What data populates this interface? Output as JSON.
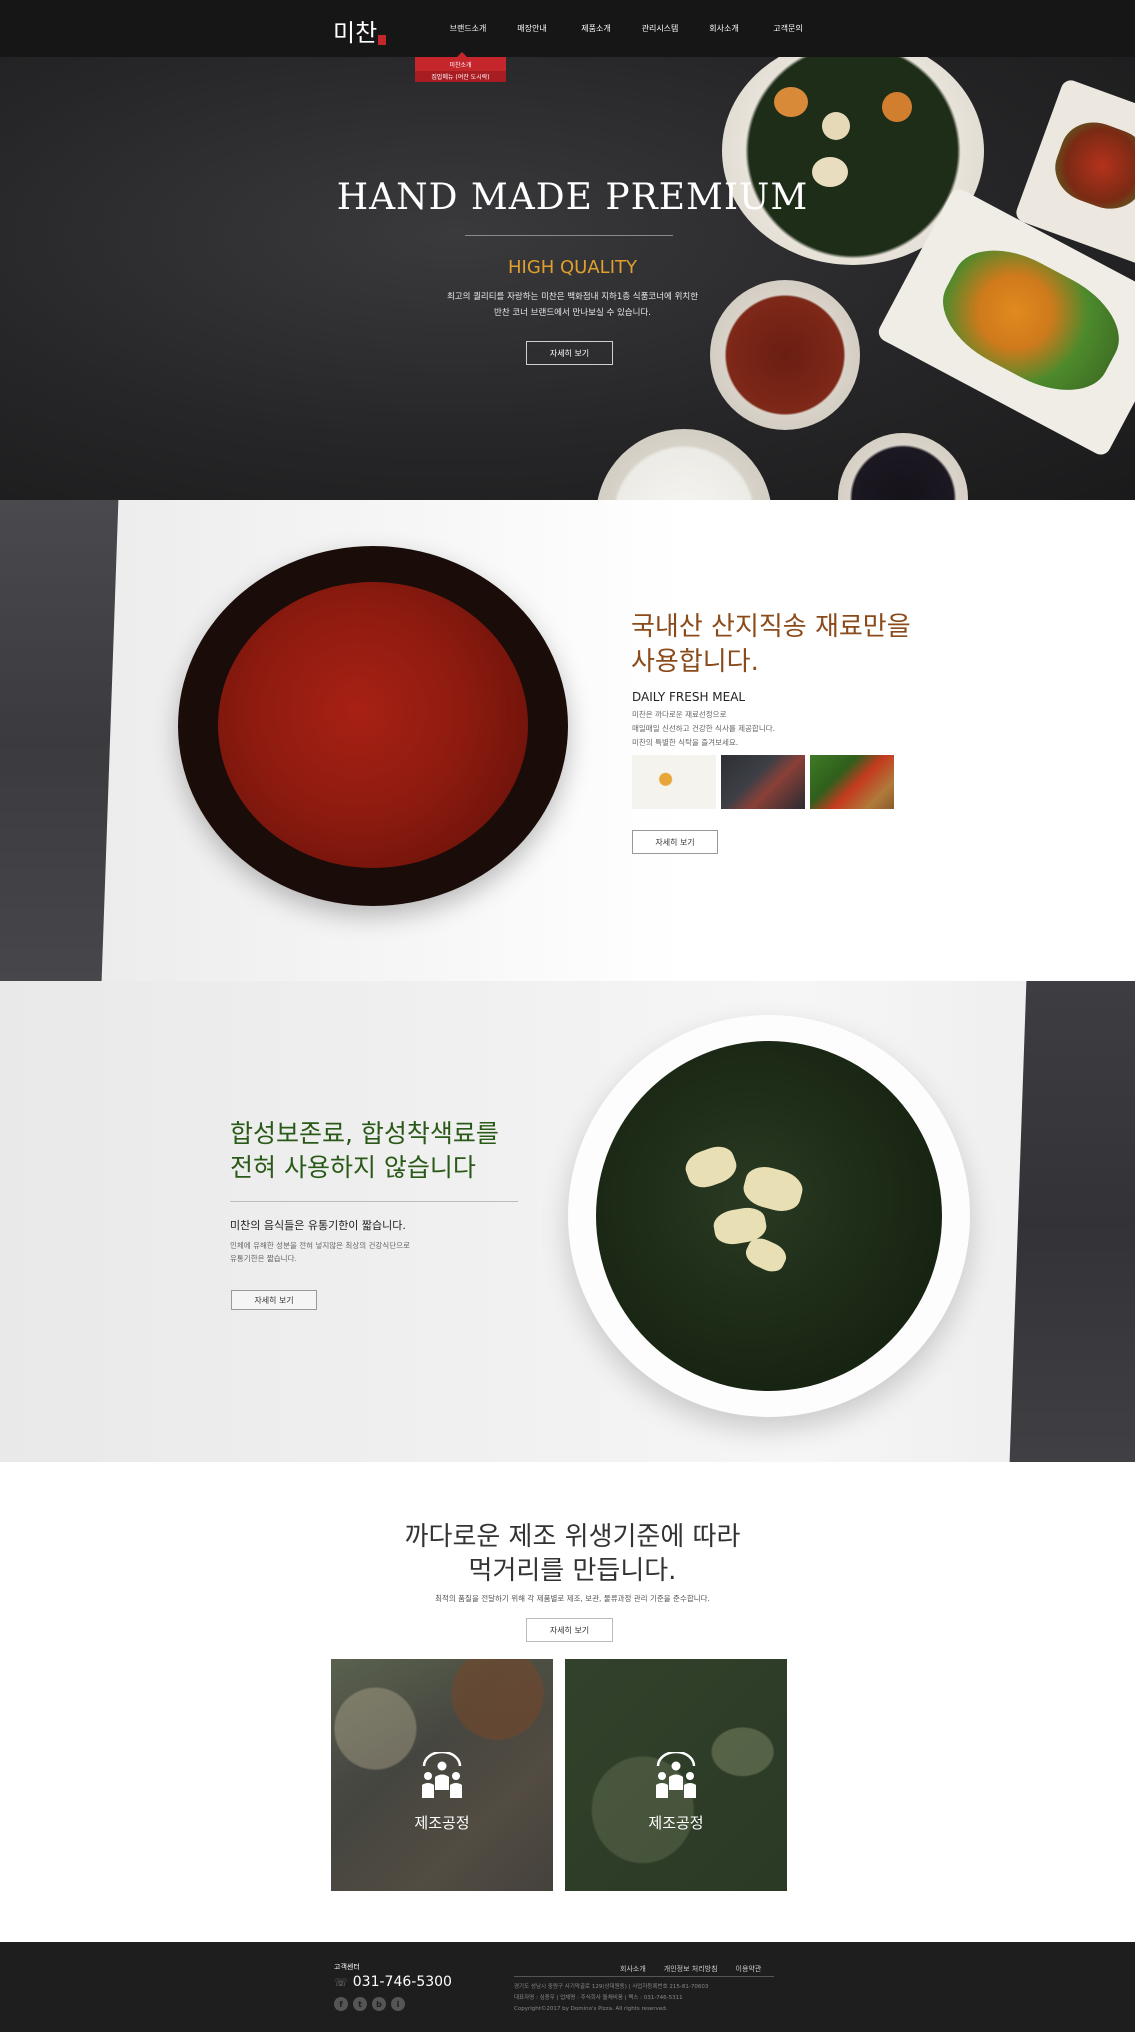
{
  "header": {
    "logo": "미찬",
    "nav": [
      "브랜드소개",
      "매장안내",
      "제품소개",
      "관리시스템",
      "회사소개",
      "고객문의"
    ],
    "dropdown": [
      "미찬소개",
      "집밥메뉴 (여잔 도시락)"
    ]
  },
  "hero": {
    "title": "HAND MADE PREMIUM",
    "subtitle": "HIGH QUALITY",
    "desc_line1": "최고의 퀄리티를 자랑하는 미찬은 백화점내 지하1층 식품코너에 위치한",
    "desc_line2": "반찬 코너 브랜드에서 만나보실 수 있습니다.",
    "button": "자세히 보기"
  },
  "section2": {
    "title_line1": "국내산 산지직송 재료만을",
    "title_line2": "사용합니다.",
    "subtitle": "DAILY FRESH MEAL",
    "desc_line1": "미찬은 까다로운 재료선정으로",
    "desc_line2": "매일매일 신선하고 건강한 식사를 제공합니다.",
    "desc_line3": "미찬의 특별한 식탁을 즐겨보세요.",
    "button": "자세히 보기"
  },
  "section3": {
    "title_line1": "합성보존료, 합성착색료를",
    "title_line2": "전혀 사용하지 않습니다",
    "subtitle": "미찬의 음식들은 유통기한이 짧습니다.",
    "desc_line1": "인체에 유해한 성분을 전혀 넣지않은 최상의 건강식단으로",
    "desc_line2": "유통기한은 짧습니다.",
    "button": "자세히 보기"
  },
  "section4": {
    "title_line1": "까다로운 제조 위생기준에 따라",
    "title_line2": "먹거리를 만듭니다.",
    "desc": "최적의 품질을 전달하기 위해 각 제품별로 제조, 보관, 물류과정 관리 기준을 준수합니다.",
    "button": "자세히 보기",
    "cards": [
      {
        "label": "제조공정",
        "icon": "people-icon"
      },
      {
        "label": "제조공정",
        "icon": "people-icon"
      }
    ]
  },
  "footer": {
    "cs_label": "고객센터",
    "phone": "031-746-5300",
    "links": [
      "회사소개",
      "개인정보 처리방침",
      "이용약관"
    ],
    "info_line1": "경기도 성남시 중원구 사기막골로 129(상대원동) | 사업자등록번호 215-81-70603",
    "info_line2": "대표자명 : 심종우 | 업체명 : 주식회사 돌체비움 | 팩스 : 031-746-5311",
    "info_line3": "Copyright©2017 by Domino's Pizza. All rights reserved.",
    "social": [
      "f",
      "t",
      "b",
      "i"
    ]
  },
  "colors": {
    "header_bg": "#161616",
    "accent_red": "#c4262b",
    "hero_gold": "#e0a02e",
    "sec2_brown": "#8a4a1a",
    "sec3_green": "#2a5a17"
  }
}
